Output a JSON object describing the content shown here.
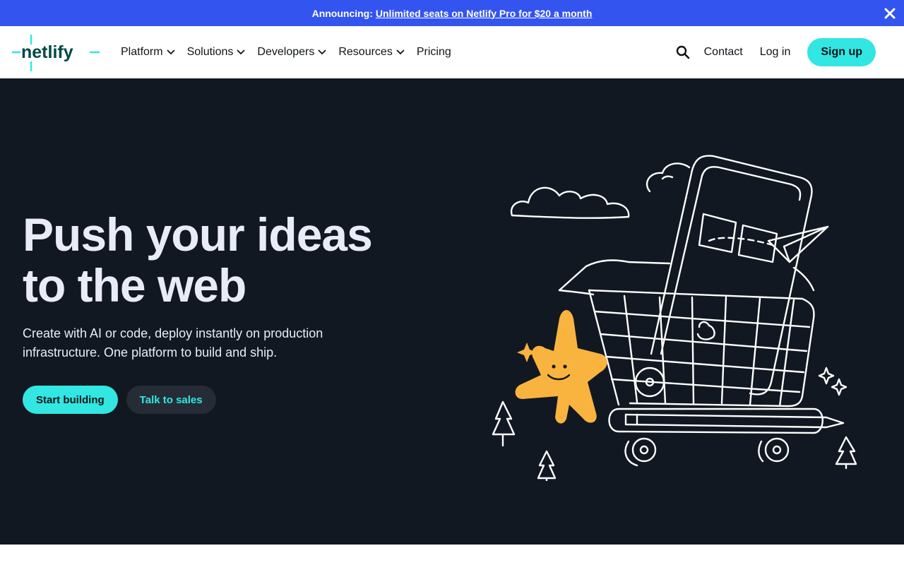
{
  "announcement": {
    "lead": "Announcing:",
    "link": "Unlimited seats on Netlify Pro for $20 a month"
  },
  "brand": {
    "name": "netlify",
    "accent": "#32e6e2",
    "announce_bg": "#3454ef",
    "hero_bg": "#121821"
  },
  "nav": {
    "items": [
      {
        "label": "Platform"
      },
      {
        "label": "Solutions"
      },
      {
        "label": "Developers"
      },
      {
        "label": "Resources"
      },
      {
        "label": "Pricing"
      }
    ],
    "contact": "Contact",
    "login": "Log in",
    "signup": "Sign up"
  },
  "hero": {
    "title_line1": "Push your ideas",
    "title_line2": "to the web",
    "subtitle": "Create with AI or code, deploy instantly on production infrastructure. One platform to build and ship.",
    "primary_cta": "Start building",
    "secondary_cta": "Talk to sales"
  },
  "icons": [
    "close-icon",
    "netlify-logo",
    "chevron-down-icon",
    "search-icon",
    "shopping-cart-illustration"
  ]
}
